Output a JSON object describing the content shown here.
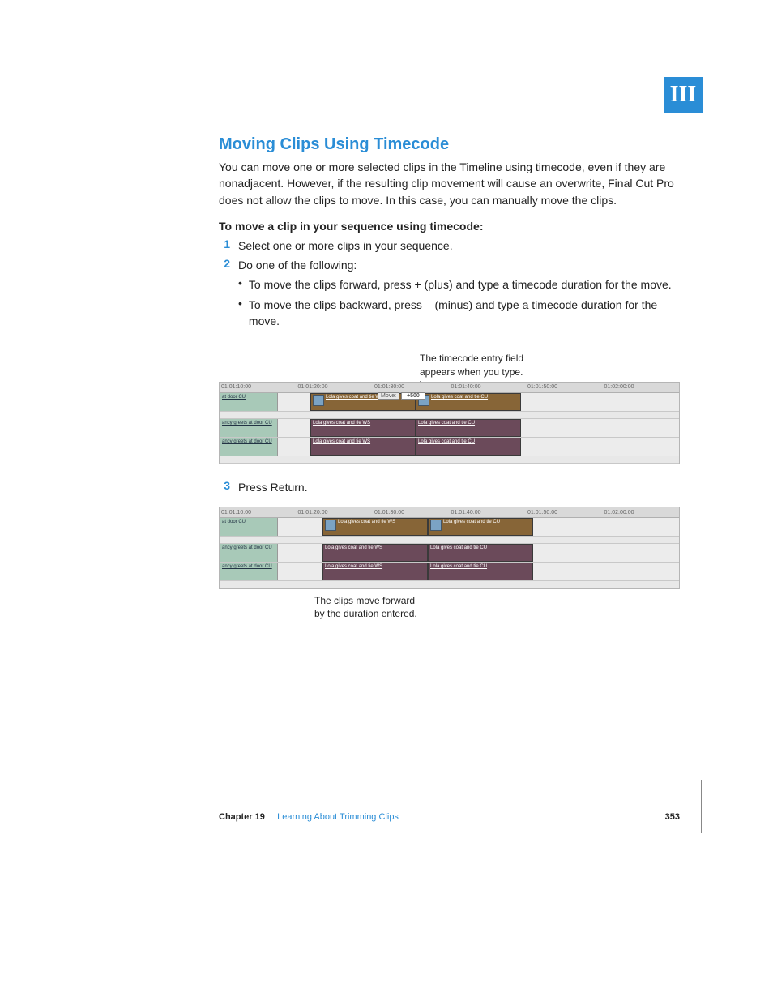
{
  "tab": "III",
  "heading": "Moving Clips Using Timecode",
  "intro": "You can move one or more selected clips in the Timeline using timecode, even if they are nonadjacent. However, if the resulting clip movement will cause an overwrite, Final Cut Pro does not allow the clips to move. In this case, you can manually move the clips.",
  "procTitle": "To move a clip in your sequence using timecode:",
  "steps": {
    "s1": {
      "n": "1",
      "t": "Select one or more clips in your sequence."
    },
    "s2": {
      "n": "2",
      "t": "Do one of the following:"
    },
    "s3": {
      "n": "3",
      "t": "Press Return."
    }
  },
  "bullets": {
    "b1": "To move the clips forward, press + (plus) and type a timecode duration for the move.",
    "b2": "To move the clips backward, press – (minus) and type a timecode duration for the move."
  },
  "caption1a": "The timecode entry field",
  "caption1b": "appears when you type.",
  "caption2a": "The clips move forward",
  "caption2b": "by the duration entered.",
  "ruler": {
    "t1": "01:01:10:00",
    "t2": "01:01:20:00",
    "t3": "01:01:30:00",
    "t4": "01:01:40:00",
    "t5": "01:01:50:00",
    "t6": "01:02:00:00"
  },
  "move": {
    "label": "Move:",
    "value": "+500"
  },
  "tracks": {
    "v1lab": "at door CU",
    "a1lab": "ancy greets at door CU",
    "a2lab": "ancy greets at door CU",
    "clipWS": "Lola gives coat and tie WS",
    "clipCU": "Lola gives coat and tie CU"
  },
  "footer": {
    "chapNum": "Chapter 19",
    "chapTitle": "Learning About Trimming Clips",
    "page": "353"
  }
}
